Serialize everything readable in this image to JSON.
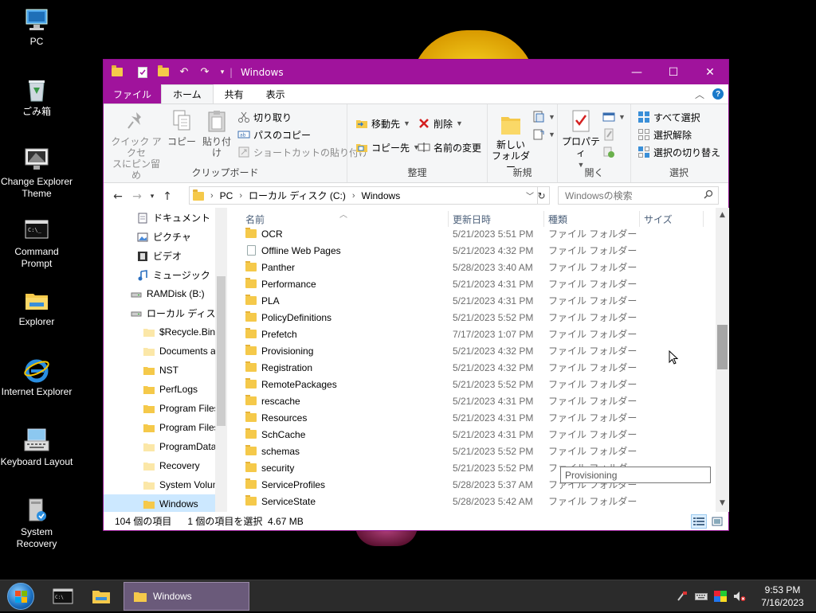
{
  "desktop": {
    "icons": [
      {
        "label": "PC"
      },
      {
        "label": "ごみ箱"
      },
      {
        "label": "Change Explorer Theme"
      },
      {
        "label": "Command Prompt"
      },
      {
        "label": "Explorer"
      },
      {
        "label": "Internet Explorer"
      },
      {
        "label": "Keyboard Layout"
      },
      {
        "label": "System Recovery"
      }
    ]
  },
  "window": {
    "title": "Windows",
    "controls": {
      "minimize": "—",
      "maximize": "☐",
      "close": "✕"
    }
  },
  "ribbon_tabs": {
    "file": "ファイル",
    "home": "ホーム",
    "share": "共有",
    "view": "表示"
  },
  "ribbon": {
    "clipboard": {
      "label": "クリップボード",
      "pin_line1": "クイック アクセ",
      "pin_line2": "スにピン留め",
      "copy": "コピー",
      "paste": "貼り付け",
      "cut": "切り取り",
      "copy_path": "パスのコピー",
      "paste_shortcut": "ショートカットの貼り付け"
    },
    "organize": {
      "label": "整理",
      "move_to": "移動先",
      "copy_to": "コピー先",
      "delete": "削除",
      "rename": "名前の変更"
    },
    "new": {
      "label": "新規",
      "new_folder_line1": "新しい",
      "new_folder_line2": "フォルダー"
    },
    "open": {
      "label": "開く",
      "properties": "プロパティ"
    },
    "select": {
      "label": "選択",
      "select_all": "すべて選択",
      "select_none": "選択解除",
      "invert": "選択の切り替え"
    }
  },
  "address": {
    "crumbs": [
      "PC",
      "ローカル ディスク (C:)",
      "Windows"
    ],
    "search_placeholder": "Windowsの検索"
  },
  "navpane": {
    "items": [
      {
        "label": "ドキュメント"
      },
      {
        "label": "ピクチャ"
      },
      {
        "label": "ビデオ"
      },
      {
        "label": "ミュージック"
      },
      {
        "label": "RAMDisk (B:)"
      },
      {
        "label": "ローカル ディスク (C:)"
      },
      {
        "label": "$Recycle.Bin"
      },
      {
        "label": "Documents a"
      },
      {
        "label": "NST"
      },
      {
        "label": "PerfLogs"
      },
      {
        "label": "Program Files"
      },
      {
        "label": "Program Files"
      },
      {
        "label": "ProgramData"
      },
      {
        "label": "Recovery"
      },
      {
        "label": "System Volum"
      },
      {
        "label": "Windows"
      }
    ]
  },
  "files": {
    "columns": {
      "name": "名前",
      "date": "更新日時",
      "type": "種類",
      "size": "サイズ"
    },
    "rows": [
      {
        "name": "OCR",
        "date": "5/21/2023 5:51 PM",
        "type": "ファイル フォルダー"
      },
      {
        "name": "Offline Web Pages",
        "date": "5/21/2023 4:32 PM",
        "type": "ファイル フォルダー"
      },
      {
        "name": "Panther",
        "date": "5/28/2023 3:40 AM",
        "type": "ファイル フォルダー"
      },
      {
        "name": "Performance",
        "date": "5/21/2023 4:31 PM",
        "type": "ファイル フォルダー"
      },
      {
        "name": "PLA",
        "date": "5/21/2023 4:31 PM",
        "type": "ファイル フォルダー"
      },
      {
        "name": "PolicyDefinitions",
        "date": "5/21/2023 5:52 PM",
        "type": "ファイル フォルダー"
      },
      {
        "name": "Prefetch",
        "date": "7/17/2023 1:07 PM",
        "type": "ファイル フォルダー"
      },
      {
        "name": "Provisioning",
        "date": "5/21/2023 4:32 PM",
        "type": "ファイル フォルダー"
      },
      {
        "name": "Registration",
        "date": "5/21/2023 4:32 PM",
        "type": "ファイル フォルダー"
      },
      {
        "name": "RemotePackages",
        "date": "5/21/2023 5:52 PM",
        "type": "ファイル フォルダー"
      },
      {
        "name": "rescache",
        "date": "5/21/2023 4:31 PM",
        "type": "ファイル フォルダー"
      },
      {
        "name": "Resources",
        "date": "5/21/2023 4:31 PM",
        "type": "ファイル フォルダー"
      },
      {
        "name": "SchCache",
        "date": "5/21/2023 4:31 PM",
        "type": "ファイル フォルダー"
      },
      {
        "name": "schemas",
        "date": "5/21/2023 5:52 PM",
        "type": "ファイル フォルダー"
      },
      {
        "name": "security",
        "date": "5/21/2023 5:52 PM",
        "type": "ファイル フォルダー"
      },
      {
        "name": "ServiceProfiles",
        "date": "5/28/2023 5:37 AM",
        "type": "ファイル フォルダー"
      },
      {
        "name": "ServiceState",
        "date": "5/28/2023 5:42 AM",
        "type": "ファイル フォルダー"
      }
    ]
  },
  "tooltip": "Provisioning",
  "status": {
    "item_count": "104 個の項目",
    "selection": "1 個の項目を選択  4.67 MB"
  },
  "taskbar": {
    "task_label": "Windows",
    "time": "9:53 PM",
    "date": "7/16/2023"
  },
  "colors": {
    "accent": "#a0139c",
    "selection": "#cce8ff",
    "folder": "#f5c94a"
  }
}
